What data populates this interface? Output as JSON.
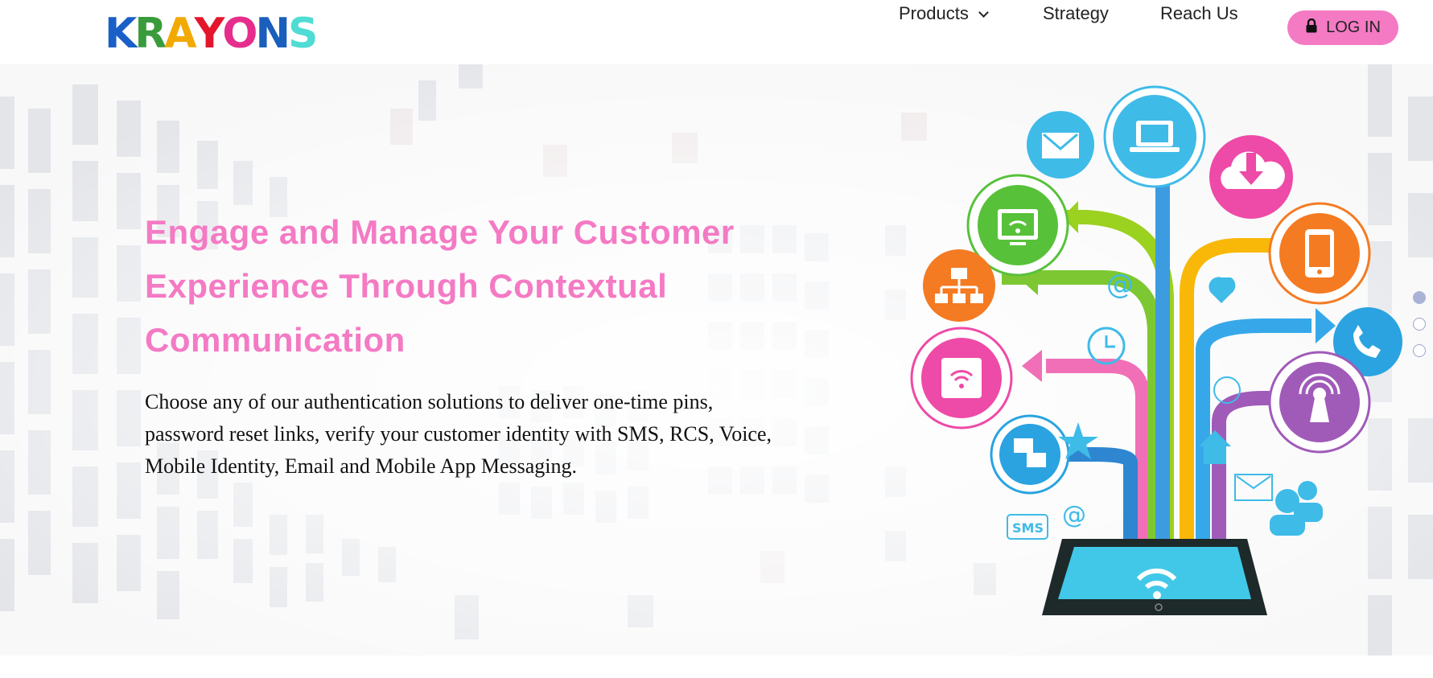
{
  "brand": {
    "logo_letters": [
      "K",
      "R",
      "A",
      "Y",
      "O",
      "N",
      "S"
    ],
    "logo_colors": [
      "#1a5fc8",
      "#3a9b3c",
      "#f2a900",
      "#e3162c",
      "#e62d8c",
      "#1b5fbd",
      "#4fdcd4"
    ]
  },
  "nav": {
    "items": [
      {
        "label": "Products",
        "has_dropdown": true
      },
      {
        "label": "Strategy"
      },
      {
        "label": "Reach Us"
      }
    ],
    "login_label": "LOG IN"
  },
  "hero": {
    "title_lines": [
      "Engage and Manage Your Customer",
      "Experience Through Contextual",
      "Communication"
    ],
    "body_lines": [
      "Choose any of our authentication solutions to deliver one-time pins,",
      "password reset links, verify your customer identity with SMS, RCS, Voice,",
      "Mobile Identity, Email and Mobile App Messaging."
    ],
    "illustration_labels": {
      "sms": "SMS",
      "at": "@"
    }
  },
  "slider": {
    "total": 3,
    "active": 0
  },
  "colors": {
    "accent_pink": "#f47ac4",
    "dot_active": "#aab3d6",
    "text_dark": "#222222"
  }
}
